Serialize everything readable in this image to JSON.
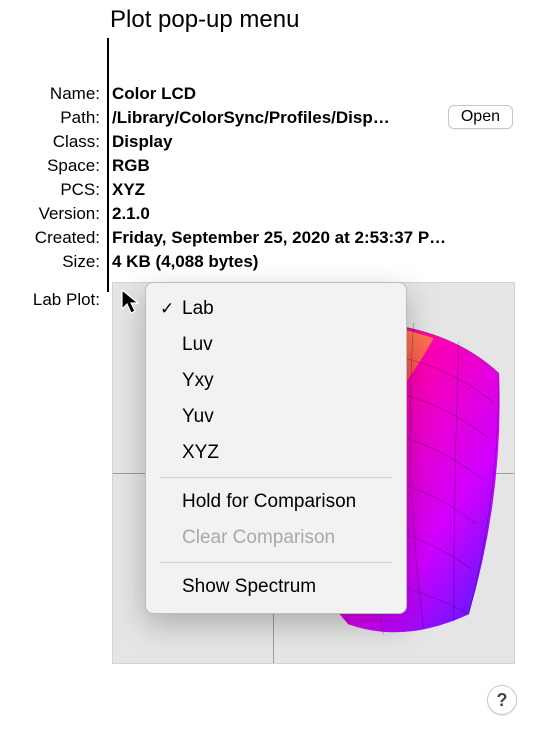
{
  "explanation_label": "Plot pop-up menu",
  "info": {
    "labels": {
      "name": "Name:",
      "path": "Path:",
      "class": "Class:",
      "space": "Space:",
      "pcs": "PCS:",
      "version": "Version:",
      "created": "Created:",
      "size": "Size:",
      "plot": "Lab Plot:"
    },
    "values": {
      "name": "Color LCD",
      "path": "/Library/ColorSync/Profiles/Disp…",
      "class": "Display",
      "space": "RGB",
      "pcs": "XYZ",
      "version": "2.1.0",
      "created": "Friday, September 25, 2020 at 2:53:37 P…",
      "size": "4 KB (4,088 bytes)"
    }
  },
  "open_button": "Open",
  "menu": {
    "items": [
      {
        "label": "Lab",
        "checked": true
      },
      {
        "label": "Luv",
        "checked": false
      },
      {
        "label": "Yxy",
        "checked": false
      },
      {
        "label": "Yuv",
        "checked": false
      },
      {
        "label": "XYZ",
        "checked": false
      }
    ],
    "hold": "Hold for Comparison",
    "clear": "Clear Comparison",
    "spectrum": "Show Spectrum"
  },
  "help_label": "?"
}
